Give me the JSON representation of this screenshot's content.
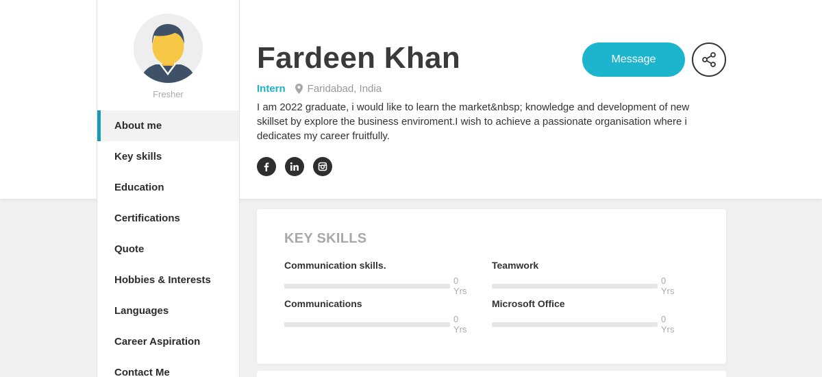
{
  "profile": {
    "name": "Fardeen Khan",
    "role": "Intern",
    "location": "Faridabad, India",
    "bio": "I am 2022 graduate, i would like to learn the market&nbsp; knowledge and development of new skillset by explore the business enviroment.I wish to achieve a passionate organisation where i dedicates my career fruitfully.",
    "status": "Fresher",
    "message_label": "Message"
  },
  "socials": [
    {
      "icon": "facebook-icon",
      "glyph": "f"
    },
    {
      "icon": "linkedin-icon",
      "glyph": "in"
    },
    {
      "icon": "instagram-icon",
      "glyph": "ig"
    }
  ],
  "sidebar": {
    "items": [
      {
        "label": "About me",
        "active": true
      },
      {
        "label": "Key skills"
      },
      {
        "label": "Education"
      },
      {
        "label": "Certifications"
      },
      {
        "label": "Quote"
      },
      {
        "label": "Hobbies & Interests"
      },
      {
        "label": "Languages"
      },
      {
        "label": "Career Aspiration"
      },
      {
        "label": "Contact Me"
      }
    ]
  },
  "key_skills": {
    "title": "KEY SKILLS",
    "items": [
      {
        "name": "Communication skills.",
        "years": "0 Yrs",
        "level": 0
      },
      {
        "name": "Teamwork",
        "years": "0 Yrs",
        "level": 0
      },
      {
        "name": "Communications",
        "years": "0 Yrs",
        "level": 0
      },
      {
        "name": "Microsoft Office",
        "years": "0 Yrs",
        "level": 0
      }
    ]
  },
  "colors": {
    "accent": "#1db5ce",
    "role_text": "#1fb0c9",
    "sidebar_active_bar": "#1a9bb5",
    "dark_icon": "#2e2e2e"
  }
}
